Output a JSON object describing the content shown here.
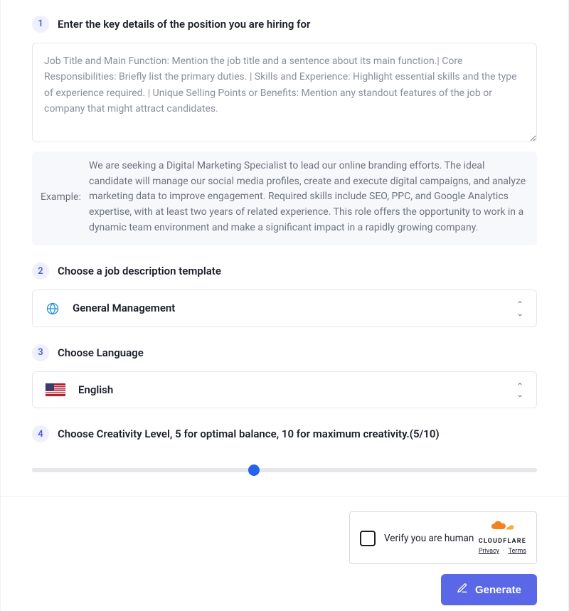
{
  "steps": {
    "s1": {
      "num": "1",
      "title": "Enter the key details of the position you are hiring for"
    },
    "s2": {
      "num": "2",
      "title": "Choose a job description template"
    },
    "s3": {
      "num": "3",
      "title": "Choose Language"
    },
    "s4": {
      "num": "4",
      "title": "Choose Creativity Level, 5 for optimal balance, 10 for maximum creativity.(5/10)"
    }
  },
  "details": {
    "placeholder": "Job Title and Main Function: Mention the job title and a sentence about its main function.| Core Responsibilities: Briefly list the primary duties. | Skills and Experience: Highlight essential skills and the type of experience required. | Unique Selling Points or Benefits: Mention any standout features of the job or company that might attract candidates.",
    "value": ""
  },
  "example": {
    "label": "Example:",
    "text": "We are seeking a Digital Marketing Specialist to lead our online branding efforts. The ideal candidate will manage our social media profiles, create and execute digital campaigns, and analyze marketing data to improve engagement. Required skills include SEO, PPC, and Google Analytics expertise, with at least two years of related experience. This role offers the opportunity to work in a dynamic team environment and make a significant impact in a rapidly growing company."
  },
  "template_select": {
    "icon": "globe-icon",
    "value": "General Management"
  },
  "language_select": {
    "icon": "flag-us",
    "value": "English"
  },
  "creativity": {
    "current": 5,
    "min": 0,
    "max": 10
  },
  "captcha": {
    "text": "Verify you are human",
    "brand": "CLOUDFLARE",
    "privacy": "Privacy",
    "terms": "Terms",
    "sep": "·"
  },
  "actions": {
    "generate": "Generate"
  },
  "colors": {
    "accent": "#5a67e6",
    "slider_thumb": "#2563eb"
  }
}
